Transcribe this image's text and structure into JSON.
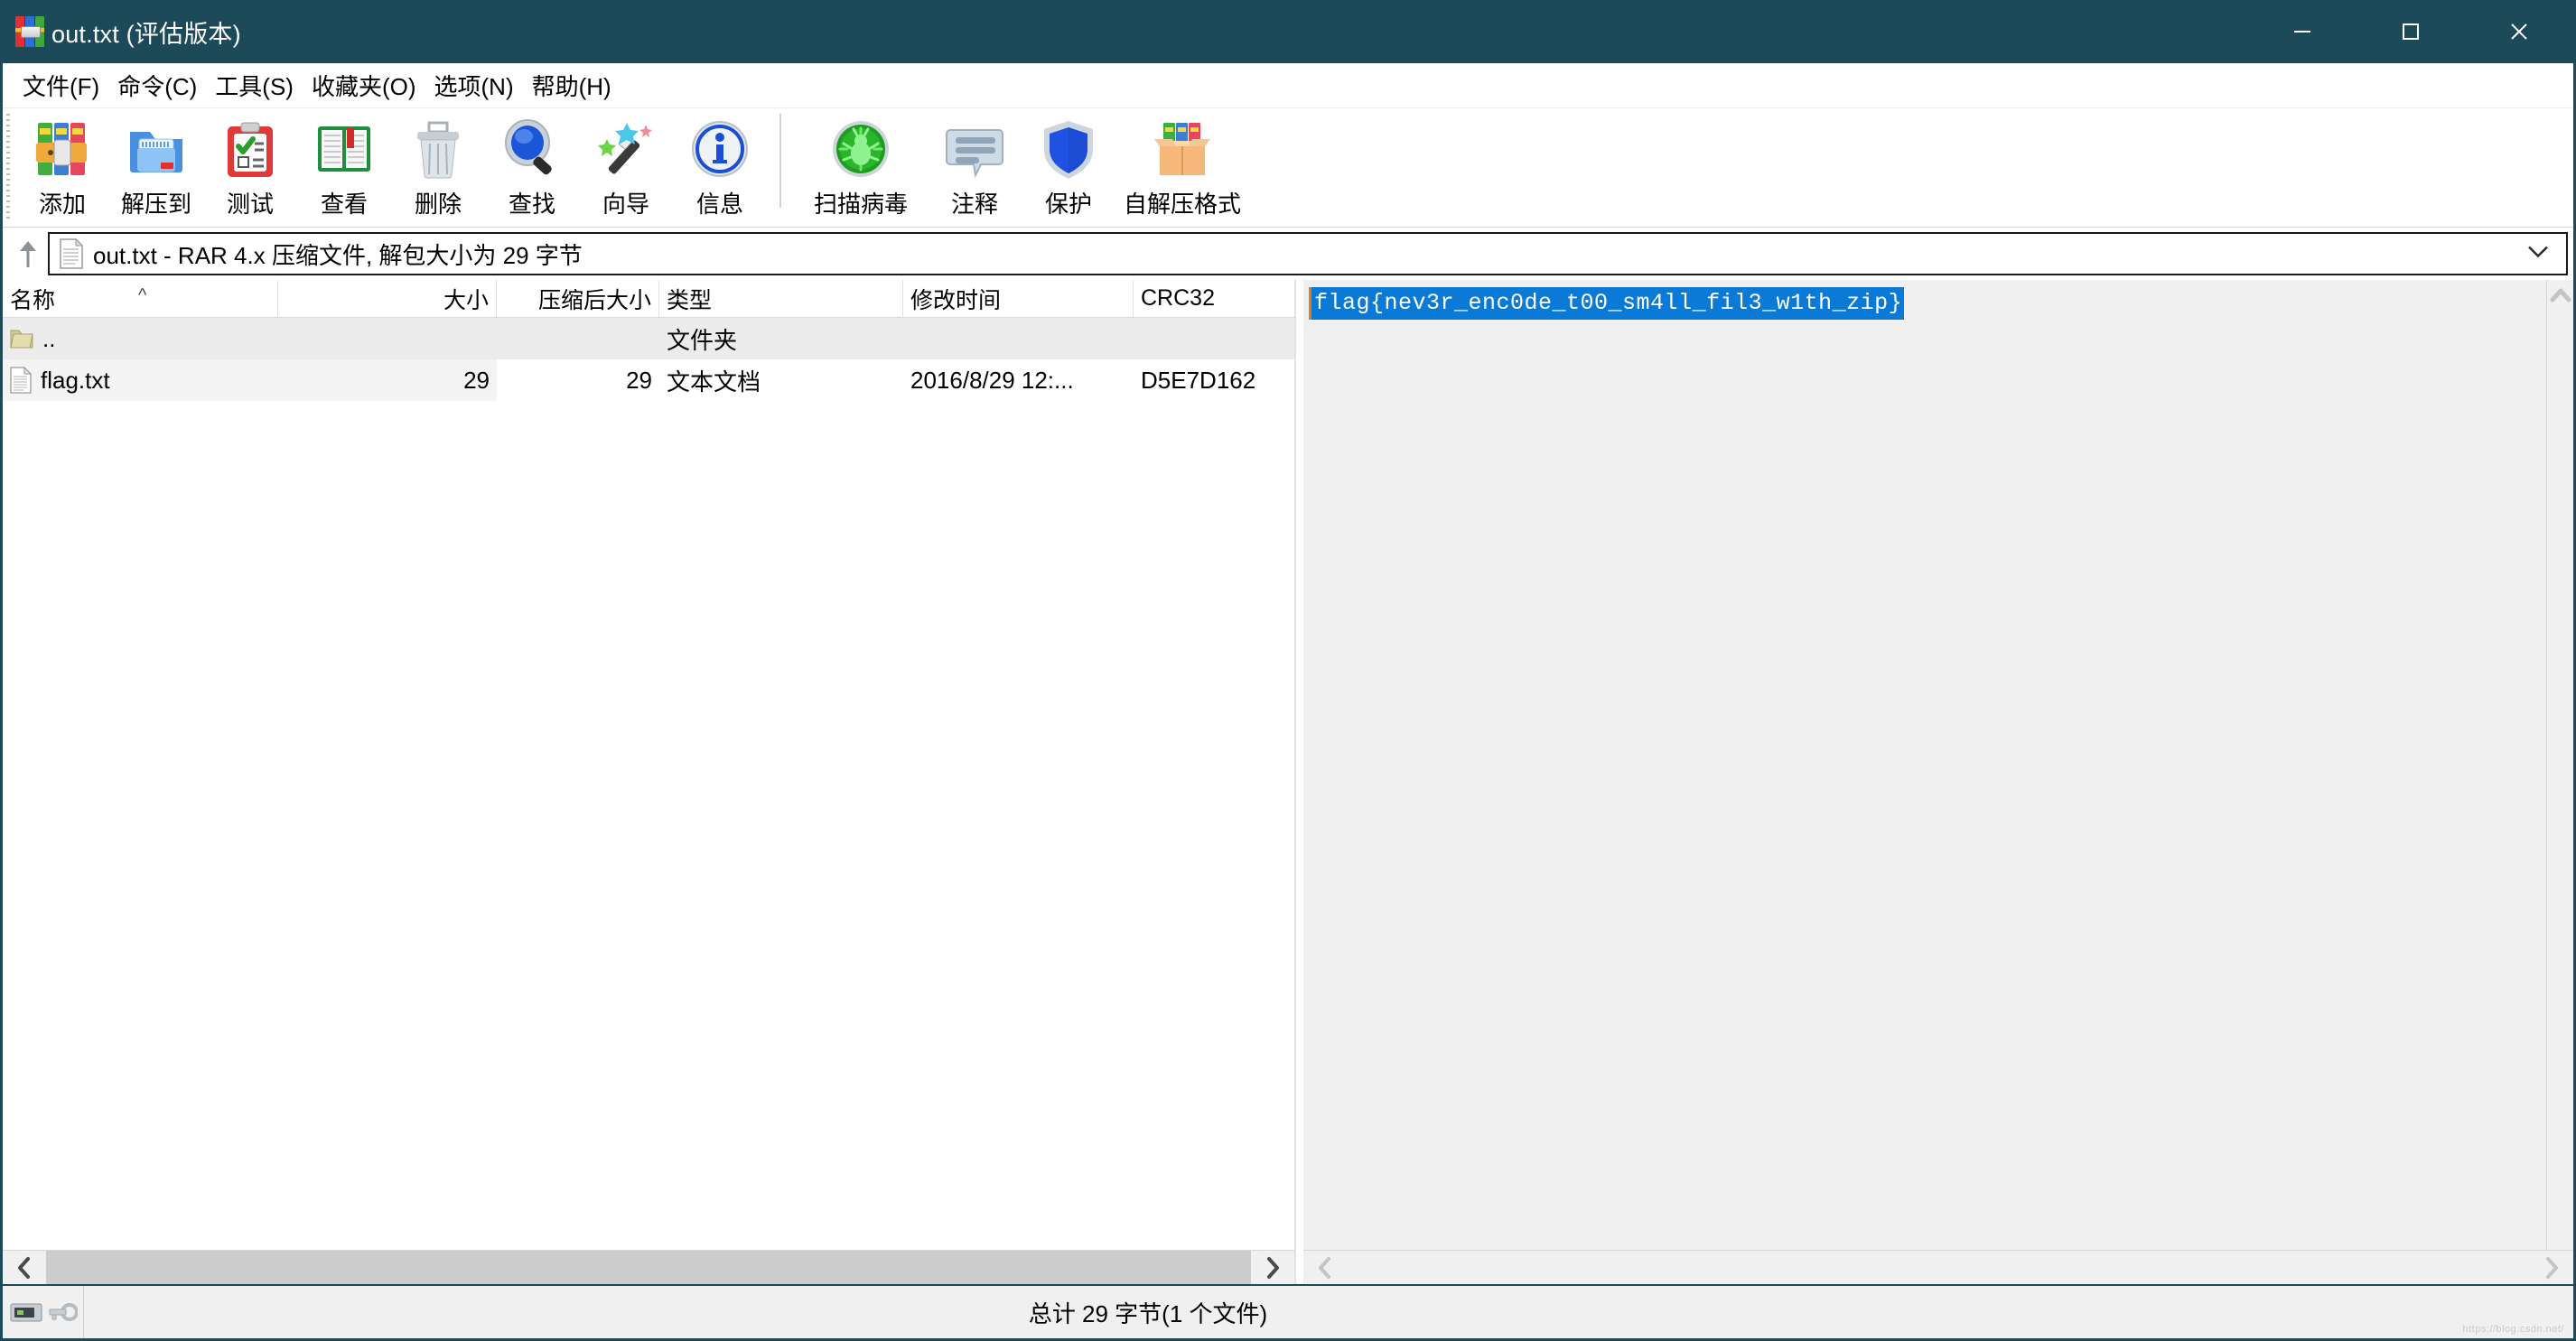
{
  "window": {
    "title": "out.txt (评估版本)",
    "logo_icon": "winrar-books-icon",
    "titlebar_color": "#1d4a59",
    "controls": {
      "minimize": "minimize-icon",
      "maximize": "maximize-icon",
      "close": "close-icon"
    }
  },
  "menu": {
    "items": [
      {
        "label": "文件(F)"
      },
      {
        "label": "命令(C)"
      },
      {
        "label": "工具(S)"
      },
      {
        "label": "收藏夹(O)"
      },
      {
        "label": "选项(N)"
      },
      {
        "label": "帮助(H)"
      }
    ]
  },
  "toolbar": {
    "buttons": [
      {
        "label": "添加",
        "icon": "add-archive-icon"
      },
      {
        "label": "解压到",
        "icon": "extract-to-folder-icon"
      },
      {
        "label": "测试",
        "icon": "test-clipboard-icon"
      },
      {
        "label": "查看",
        "icon": "view-book-icon"
      },
      {
        "label": "删除",
        "icon": "delete-trash-icon"
      },
      {
        "label": "查找",
        "icon": "find-magnifier-icon"
      },
      {
        "label": "向导",
        "icon": "wizard-wand-icon"
      },
      {
        "label": "信息",
        "icon": "info-circle-icon"
      },
      {
        "label": "扫描病毒",
        "icon": "virus-scan-bug-icon"
      },
      {
        "label": "注释",
        "icon": "comment-bubble-icon"
      },
      {
        "label": "保护",
        "icon": "protect-shield-icon"
      },
      {
        "label": "自解压格式",
        "icon": "sfx-box-icon"
      }
    ],
    "separator_after_index": 7
  },
  "address": {
    "up_icon": "up-arrow-icon",
    "file_icon": "text-file-icon",
    "text": "out.txt - RAR 4.x 压缩文件, 解包大小为 29 字节",
    "dropdown_icon": "chevron-down-icon"
  },
  "file_list": {
    "columns": [
      {
        "key": "name",
        "label": "名称",
        "sorted": true,
        "sort_indicator": "^"
      },
      {
        "key": "size",
        "label": "大小"
      },
      {
        "key": "packed",
        "label": "压缩后大小"
      },
      {
        "key": "type",
        "label": "类型"
      },
      {
        "key": "mtime",
        "label": "修改时间"
      },
      {
        "key": "crc",
        "label": "CRC32"
      }
    ],
    "rows": [
      {
        "name": "..",
        "icon": "folder-up-icon",
        "size": "",
        "packed": "",
        "type": "文件夹",
        "mtime": "",
        "crc": "",
        "selected": true
      },
      {
        "name": "flag.txt",
        "icon": "text-file-icon",
        "size": "29",
        "packed": "29",
        "type": "文本文档",
        "mtime": "2016/8/29 12:...",
        "crc": "D5E7D162",
        "selected": false
      }
    ]
  },
  "preview": {
    "content": "flag{nev3r_enc0de_t00_sm4ll_fil3_w1th_zip}",
    "selection_color": "#0a7ad6",
    "caret_color": "#e07b20",
    "scroll_up_icon": "scroll-up-arrow-icon",
    "scroll_left_icon": "scroll-left-arrow-icon",
    "scroll_right_icon": "scroll-right-arrow-icon"
  },
  "left_scroll": {
    "left_icon": "scroll-left-arrow-icon",
    "right_icon": "scroll-right-arrow-icon"
  },
  "statusbar": {
    "drive_icon": "drive-icon",
    "key_icon": "key-icon",
    "total_text": "总计 29 字节(1 个文件)",
    "watermark": "https://blog.csdn.net/"
  }
}
